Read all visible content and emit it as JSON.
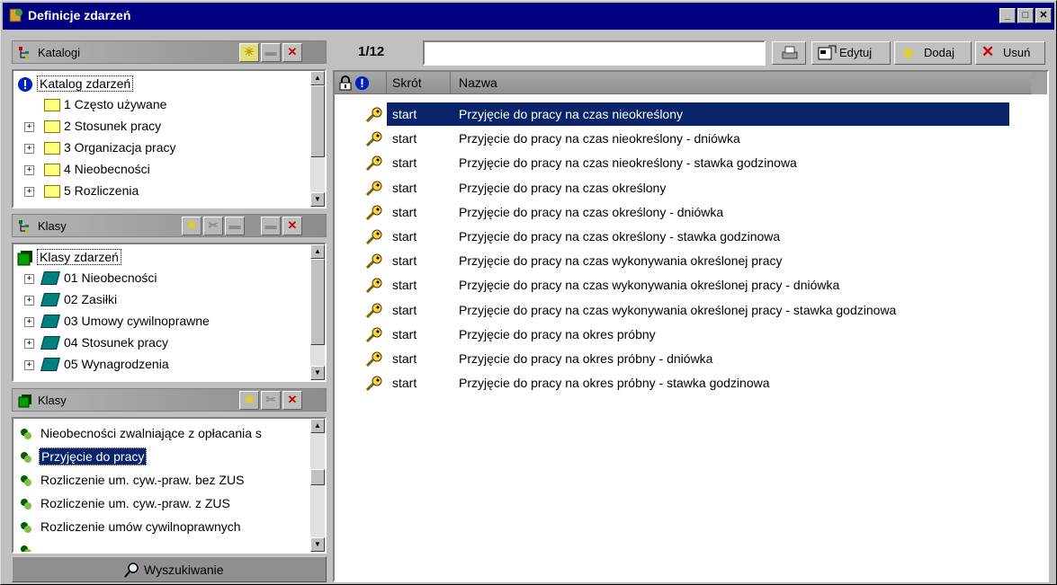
{
  "window": {
    "title": "Definicje zdarzeń"
  },
  "catalogs": {
    "header": "Katalogi",
    "root": "Katalog zdarzeń",
    "items": [
      "1 Często używane",
      "2 Stosunek pracy",
      "3 Organizacja pracy",
      "4 Nieobecności",
      "5 Rozliczenia"
    ]
  },
  "classes_tree": {
    "header": "Klasy",
    "root": "Klasy zdarzeń",
    "items": [
      "01 Nieobecności",
      "02 Zasiłki",
      "03 Umowy cywilnoprawne",
      "04 Stosunek pracy",
      "05 Wynagrodzenia"
    ]
  },
  "classes_list": {
    "header": "Klasy",
    "items": [
      "Nieobecności zwalniające z opłacania s",
      "Przyjęcie do pracy",
      "Rozliczenie um. cyw.-praw. bez ZUS",
      "Rozliczenie um. cyw.-praw. z ZUS",
      "Rozliczenie umów cywilnoprawnych"
    ],
    "selected_index": 1
  },
  "search_button": "Wyszukiwanie",
  "toolbar": {
    "record_counter": "1/12",
    "search_value": "",
    "edit_label": "Edytuj",
    "add_label": "Dodaj",
    "delete_label": "Usuń"
  },
  "table": {
    "columns": [
      "Skrót",
      "Nazwa"
    ],
    "rows": [
      {
        "skrot": "start",
        "nazwa": "Przyjęcie do pracy na czas nieokreślony"
      },
      {
        "skrot": "start",
        "nazwa": "Przyjęcie do pracy na czas nieokreślony - dniówka"
      },
      {
        "skrot": "start",
        "nazwa": "Przyjęcie do pracy na czas nieokreślony - stawka godzinowa"
      },
      {
        "skrot": "start",
        "nazwa": "Przyjęcie do pracy na czas określony"
      },
      {
        "skrot": "start",
        "nazwa": "Przyjęcie do pracy na czas określony - dniówka"
      },
      {
        "skrot": "start",
        "nazwa": "Przyjęcie do pracy na czas określony - stawka godzinowa"
      },
      {
        "skrot": "start",
        "nazwa": "Przyjęcie do pracy na czas wykonywania określonej pracy"
      },
      {
        "skrot": "start",
        "nazwa": "Przyjęcie do pracy na czas wykonywania określonej pracy - dniówka"
      },
      {
        "skrot": "start",
        "nazwa": "Przyjęcie do pracy na czas wykonywania określonej pracy - stawka godzinowa"
      },
      {
        "skrot": "start",
        "nazwa": "Przyjęcie do pracy na okres próbny"
      },
      {
        "skrot": "start",
        "nazwa": "Przyjęcie do pracy na okres próbny - dniówka"
      },
      {
        "skrot": "start",
        "nazwa": "Przyjęcie do pracy na okres próbny - stawka godzinowa"
      }
    ],
    "selected_index": 0
  },
  "colors": {
    "title_bar": "#000080",
    "selection": "#0a246a",
    "delete_red": "#cc0000",
    "add_yellow": "#e8d800"
  }
}
